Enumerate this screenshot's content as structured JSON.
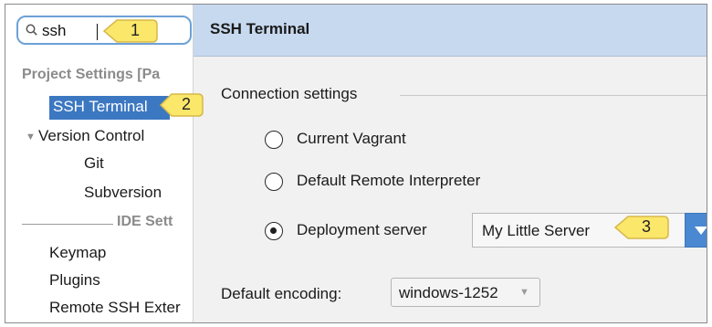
{
  "search": {
    "value": "ssh"
  },
  "tree": {
    "project_settings_header": "Project Settings [Pa",
    "items": {
      "ssh_terminal": "SSH Terminal",
      "version_control": "Version Control",
      "git": "Git",
      "subversion": "Subversion"
    },
    "ide_settings_header": "IDE Sett",
    "ide_items": {
      "keymap": "Keymap",
      "plugins": "Plugins",
      "remote_ssh": "Remote SSH Exter"
    }
  },
  "panel": {
    "title": "SSH Terminal",
    "connection_settings_label": "Connection settings",
    "radios": {
      "current_vagrant": "Current Vagrant",
      "default_remote": "Default Remote Interpreter",
      "deployment_server": "Deployment server"
    },
    "selected_radio": "deployment_server",
    "server_combo": {
      "value": "My Little Server"
    },
    "encoding": {
      "label": "Default encoding:",
      "value": "windows-1252"
    }
  },
  "callouts": {
    "one": "1",
    "two": "2",
    "three": "3"
  },
  "colors": {
    "selection": "#3c78c2",
    "title_bar": "#c7d9ef",
    "callout": "#fbe76a",
    "dropdown_button": "#4a88d1"
  }
}
